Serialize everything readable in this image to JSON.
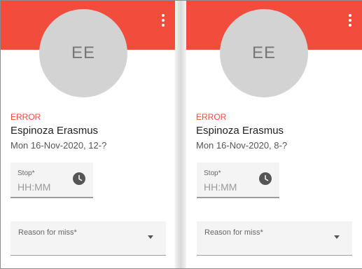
{
  "cards": [
    {
      "avatar_initials": "EE",
      "status": "ERROR",
      "name": "Espinoza Erasmus",
      "date": "Mon 16-Nov-2020, 12-?",
      "stop": {
        "label": "Stop*",
        "placeholder": "HH:MM",
        "value": ""
      },
      "reason": {
        "label": "Reason for miss*",
        "value": ""
      }
    },
    {
      "avatar_initials": "EE",
      "status": "ERROR",
      "name": "Espinoza Erasmus",
      "date": "Mon 16-Nov-2020, 8-?",
      "stop": {
        "label": "Stop*",
        "placeholder": "HH:MM",
        "value": ""
      },
      "reason": {
        "label": "Reason for miss*",
        "value": ""
      }
    }
  ],
  "icons": {
    "more": "more-vert-icon",
    "clock": "clock-icon",
    "dropdown": "arrow-drop-down-icon"
  },
  "colors": {
    "header": "#f14c3c",
    "error_text": "#f14c3c",
    "avatar_bg": "#d3d3d3",
    "field_bg": "#f4f4f4"
  }
}
